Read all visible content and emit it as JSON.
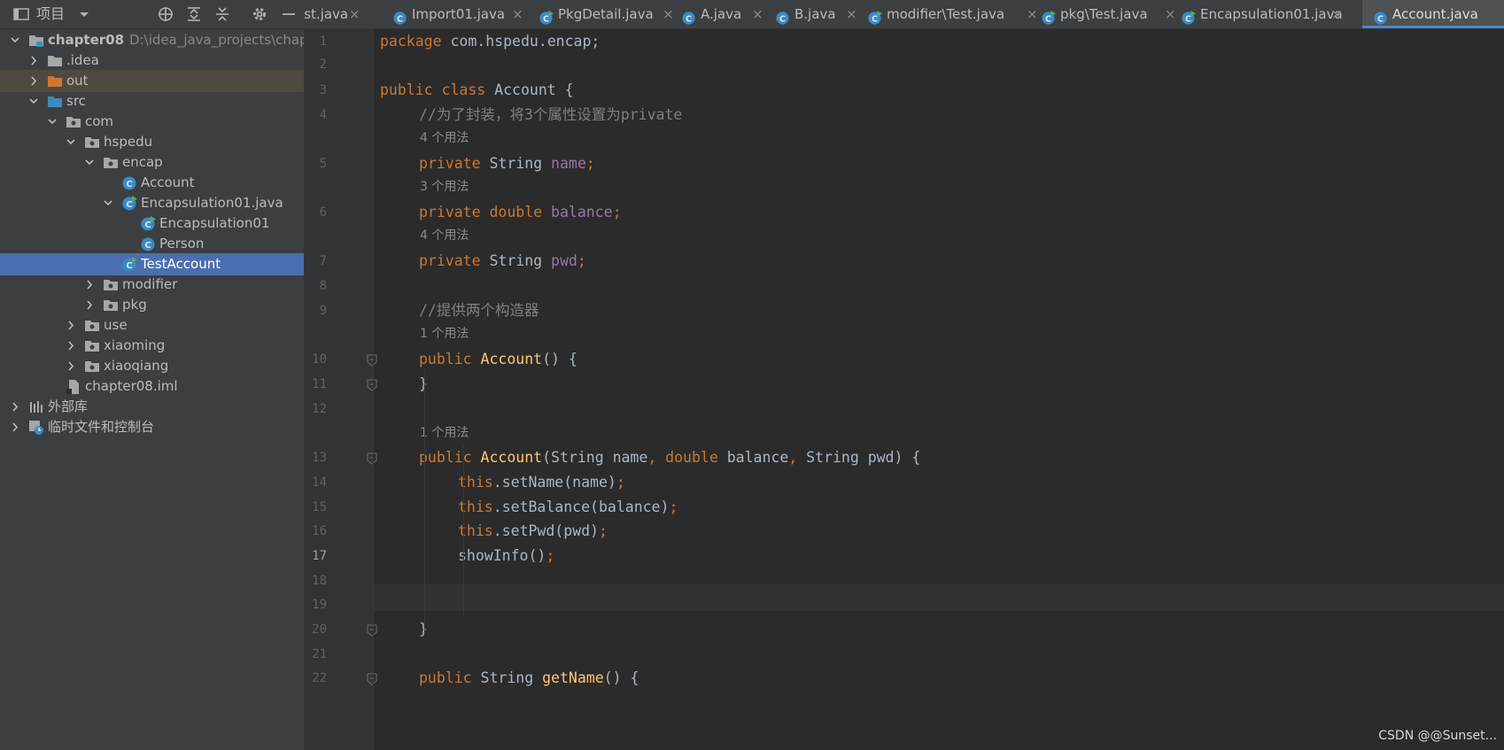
{
  "project_panel": {
    "title": "项目",
    "tree": [
      {
        "label": "chapter08",
        "path": "D:\\idea_java_projects\\chapte"
      },
      {
        "label": ".idea"
      },
      {
        "label": "out"
      },
      {
        "label": "src"
      },
      {
        "label": "com"
      },
      {
        "label": "hspedu"
      },
      {
        "label": "encap"
      },
      {
        "label": "Account"
      },
      {
        "label": "Encapsulation01.java"
      },
      {
        "label": "Encapsulation01"
      },
      {
        "label": "Person"
      },
      {
        "label": "TestAccount"
      },
      {
        "label": "modifier"
      },
      {
        "label": "pkg"
      },
      {
        "label": "use"
      },
      {
        "label": "xiaoming"
      },
      {
        "label": "xiaoqiang"
      },
      {
        "label": "chapter08.iml"
      },
      {
        "label": "外部库"
      },
      {
        "label": "临时文件和控制台"
      }
    ]
  },
  "tabs": [
    {
      "label": "est.java"
    },
    {
      "label": "Import01.java"
    },
    {
      "label": "PkgDetail.java"
    },
    {
      "label": "A.java"
    },
    {
      "label": "B.java"
    },
    {
      "label": "modifier\\Test.java"
    },
    {
      "label": "pkg\\Test.java"
    },
    {
      "label": "Encapsulation01.java"
    },
    {
      "label": "Account.java"
    }
  ],
  "editor": {
    "line_numbers": [
      "1",
      "2",
      "3",
      "4",
      "5",
      "6",
      "7",
      "8",
      "9",
      "10",
      "11",
      "12",
      "13",
      "14",
      "15",
      "16",
      "17",
      "18",
      "19",
      "20",
      "21",
      "22"
    ],
    "hints": [
      "4 个用法",
      "3 个用法",
      "4 个用法",
      "1 个用法",
      "1 个用法"
    ],
    "code": {
      "l1_kw": "package",
      "l1_rest": " com.hspedu.encap;",
      "l3_kw": "public class",
      "l3_rest": " Account {",
      "l4_comment": "//为了封装，将3个属性设置为private",
      "l5_kw": "private",
      "l5_type": " String ",
      "l5_field": "name",
      "l5_end": ";",
      "l6_kw": "private double",
      "l6_sp": " ",
      "l6_field": "balance",
      "l6_end": ";",
      "l7_kw": "private",
      "l7_type": " String ",
      "l7_field": "pwd",
      "l7_end": ";",
      "l9_comment": "//提供两个构造器",
      "l10_kw": "public",
      "l10_sp": " ",
      "l10_fn": "Account",
      "l10_rest": "() {",
      "l11": "}",
      "l13_kw": "public",
      "l13_sp": " ",
      "l13_fn": "Account",
      "l13_a": "(String name",
      "l13_c1": ",",
      "l13_kw2": " double",
      "l13_b": " balance",
      "l13_c2": ",",
      "l13_c": " String pwd) {",
      "l14_kw": "this",
      "l14_rest": ".setName(name)",
      "l14_end": ";",
      "l15_kw": "this",
      "l15_rest": ".setBalance(balance)",
      "l15_end": ";",
      "l16_kw": "this",
      "l16_rest": ".setPwd(pwd)",
      "l16_end": ";",
      "l17_rest": "showInfo()",
      "l17_end": ";",
      "l20": "}",
      "l22_kw": "public",
      "l22_type": " String ",
      "l22_fn": "getName",
      "l22_rest": "() {"
    }
  },
  "watermark": "CSDN @@Sunset...",
  "colors": {
    "keyword": "#cc7832",
    "field": "#9876aa",
    "method": "#ffc66d",
    "comment": "#808080",
    "selection": "#4b6eaf",
    "active_tab_underline": "#4a88c7"
  }
}
